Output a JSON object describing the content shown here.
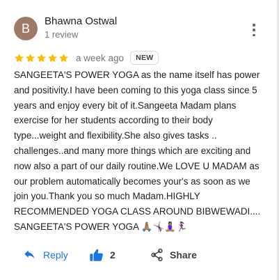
{
  "reviewer": {
    "initial": "B",
    "name": "Bhawna Ostwal",
    "review_count": "1 review",
    "avatar_color": "#a07a68"
  },
  "more_menu": {
    "icon": "more-vert-icon"
  },
  "rating": {
    "stars": 5,
    "max_stars": 5,
    "star_color": "#fbbc04",
    "time_ago": "a week ago",
    "badge": "NEW"
  },
  "review": {
    "text": "SANGEETA'S POWER YOGA as the name itself has power and positivity.I have been coming to this yoga class since 5 years and enjoy every bit of it.Sangeeta Madam plans exercise for her students according to their body type...weight and flexibility.She also gives tasks .. challenges..and many more things which are exciting and now also a part of our daily routine.We LOVE U MADAM as our problem automatically becomes your's as soon as we join you.Thank you so much Madam.HIGHLY RECOMMENDED YOGA CLASS AROUND BIBWEWADI.... SANGEETA'S POWER YOGA 🙏🏽🤸🏽‍♀️🧘🏽‍♀️🏃🏽‍♀️"
  },
  "actions": {
    "reply": {
      "label": "Reply",
      "icon": "reply-icon",
      "color": "#1a73e8"
    },
    "like": {
      "count": "2",
      "icon": "thumbs-up-icon",
      "color": "#1a73e8"
    },
    "share": {
      "label": "Share",
      "icon": "share-icon"
    }
  }
}
